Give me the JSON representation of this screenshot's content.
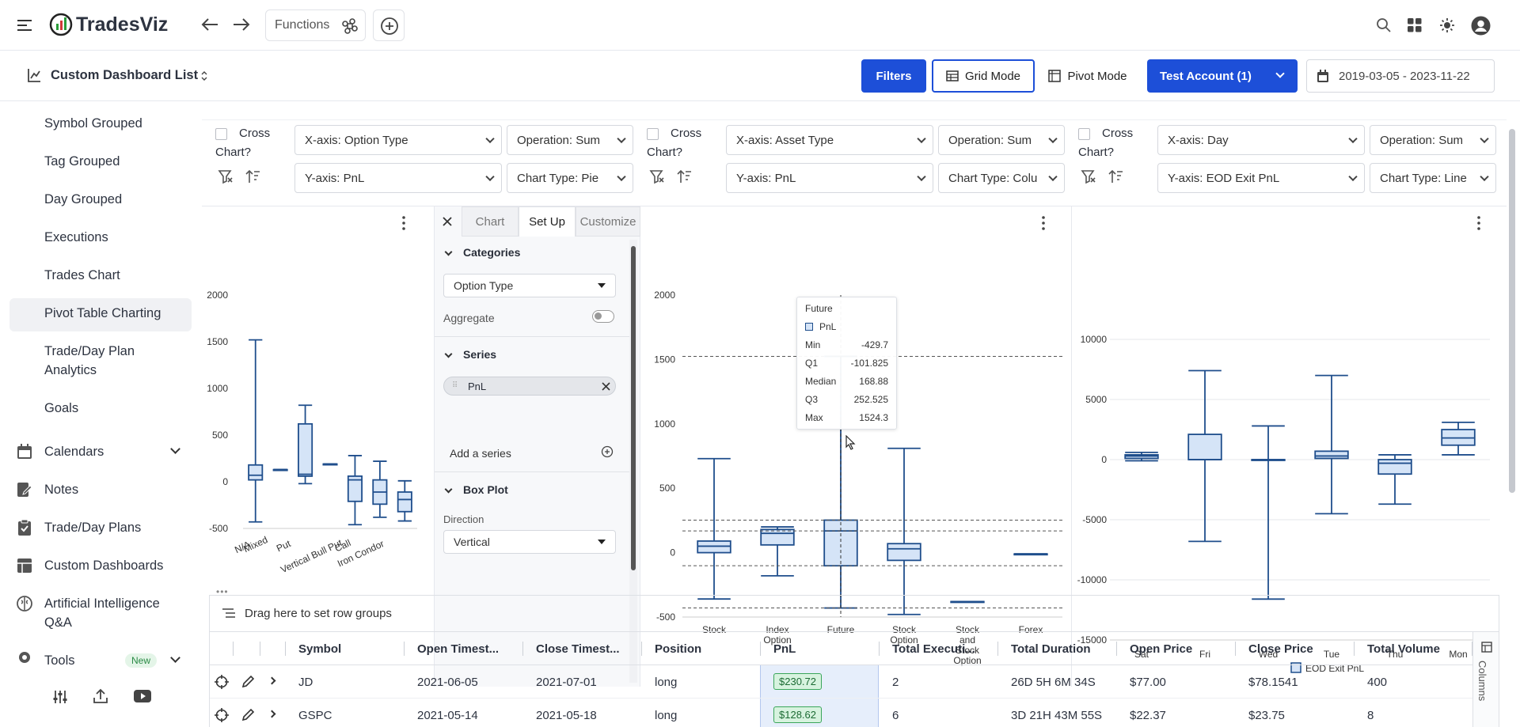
{
  "app": {
    "name": "TradesViz",
    "functions_label": "Functions"
  },
  "subbar": {
    "dashboard_title": "Custom Dashboard List",
    "filters": "Filters",
    "grid_mode": "Grid Mode",
    "pivot_mode": "Pivot Mode",
    "account": "Test Account (1)",
    "date_range": "2019-03-05 - 2023-11-22"
  },
  "sidebar": {
    "sub_items": [
      "Symbol Grouped",
      "Tag Grouped",
      "Day Grouped",
      "Executions",
      "Trades Chart",
      "Pivot Table Charting",
      "Trade/Day Plan",
      "Analytics",
      "Goals"
    ],
    "items": [
      "Calendars",
      "Notes",
      "Trade/Day Plans",
      "Custom Dashboards",
      "Artificial Intelligence",
      "Q&A",
      "Tools"
    ],
    "new_badge": "New"
  },
  "panels": [
    {
      "cross": "Cross",
      "chart": "Chart?",
      "xaxis": "X-axis: Option Type",
      "op": "Operation: Sum",
      "yaxis": "Y-axis: PnL",
      "ctype": "Chart Type: Pie"
    },
    {
      "cross": "Cross",
      "chart": "Chart?",
      "xaxis": "X-axis: Asset Type",
      "op": "Operation: Sum",
      "yaxis": "Y-axis: PnL",
      "ctype": "Chart Type: Colu"
    },
    {
      "cross": "Cross",
      "chart": "Chart?",
      "xaxis": "X-axis: Day",
      "op": "Operation: Sum",
      "yaxis": "Y-axis: EOD Exit PnL",
      "ctype": "Chart Type: Line"
    }
  ],
  "setup": {
    "tabs": [
      "Chart",
      "Set Up",
      "Customize"
    ],
    "categories": "Categories",
    "category_value": "Option Type",
    "aggregate": "Aggregate",
    "series": "Series",
    "series_chip": "PnL",
    "add_series": "Add a series",
    "box_plot": "Box Plot",
    "direction": "Direction",
    "direction_value": "Vertical"
  },
  "tooltip": {
    "title": "Future",
    "series": "PnL",
    "rows": [
      [
        "Min",
        "-429.7"
      ],
      [
        "Q1",
        "-101.825"
      ],
      [
        "Median",
        "168.88"
      ],
      [
        "Q3",
        "252.525"
      ],
      [
        "Max",
        "1524.3"
      ]
    ]
  },
  "grid": {
    "drag_hint": "Drag here to set row groups",
    "columns": [
      "Symbol",
      "Open Timest...",
      "Close Timest...",
      "Position",
      "PnL",
      "Total Executi...",
      "Total Duration",
      "Open Price",
      "Close Price",
      "Total Volume"
    ],
    "side_label": "Columns",
    "rows": [
      [
        "JD",
        "2021-06-05",
        "2021-07-01",
        "long",
        "$230.72",
        "2",
        "26D 5H 6M 34S",
        "$77.00",
        "$78.1541",
        "400"
      ],
      [
        "GSPC",
        "2021-05-14",
        "2021-05-18",
        "long",
        "$128.62",
        "6",
        "3D 21H 43M 55S",
        "$22.37",
        "$23.75",
        "8"
      ]
    ]
  },
  "chart_data": [
    {
      "type": "boxplot",
      "categories": [
        "N/A",
        "Mixed",
        "Put",
        "Vertical Bull Put",
        "Call",
        "Iron Condor"
      ],
      "boxes": [
        {
          "min": -430,
          "q1": 20,
          "median": 70,
          "q3": 180,
          "max": 1520
        },
        {
          "min": 130,
          "q1": 130,
          "median": 130,
          "q3": 130,
          "max": 130
        },
        {
          "min": -20,
          "q1": 60,
          "median": 80,
          "q3": 620,
          "max": 820
        },
        {
          "min": 190,
          "q1": 190,
          "median": 190,
          "q3": 190,
          "max": 190
        },
        {
          "min": -460,
          "q1": -210,
          "median": 20,
          "q3": 60,
          "max": 280
        },
        {
          "min": -380,
          "q1": -240,
          "median": -110,
          "q3": 20,
          "max": 220
        },
        {
          "min": -420,
          "q1": -320,
          "median": -190,
          "q3": -110,
          "max": 10
        }
      ],
      "ylim": [
        -500,
        2000
      ],
      "yticks": [
        2000,
        1500,
        1000,
        500,
        0,
        -500
      ]
    },
    {
      "type": "boxplot",
      "categories": [
        "Stock",
        "Index Option",
        "Future",
        "Stock Option",
        "Stock and Stock Option",
        "Forex"
      ],
      "boxes": [
        {
          "min": -360,
          "q1": 0,
          "median": 50,
          "q3": 90,
          "max": 730
        },
        {
          "min": -180,
          "q1": 60,
          "median": 150,
          "q3": 180,
          "max": 200
        },
        {
          "min": -429.7,
          "q1": -101.825,
          "median": 168.88,
          "q3": 252.525,
          "max": 1524.3
        },
        {
          "min": -480,
          "q1": -60,
          "median": 30,
          "q3": 70,
          "max": 810
        },
        {
          "min": -380,
          "q1": -380,
          "median": -380,
          "q3": -380,
          "max": -380
        },
        {
          "min": -10,
          "q1": -10,
          "median": -10,
          "q3": -10,
          "max": -10
        }
      ],
      "ylim": [
        -500,
        2000
      ],
      "yticks": [
        2000,
        1500,
        1000,
        500,
        0,
        -500
      ]
    },
    {
      "type": "boxplot",
      "categories": [
        "Sat",
        "Fri",
        "Wed",
        "Tue",
        "Thu",
        "Mon"
      ],
      "series": [
        {
          "name": "EOD Exit PnL"
        }
      ],
      "boxes": [
        {
          "min": -100,
          "q1": 100,
          "median": 300,
          "q3": 400,
          "max": 600
        },
        {
          "min": -6800,
          "q1": 0,
          "median": 0,
          "q3": 2100,
          "max": 7400
        },
        {
          "min": -11600,
          "q1": 0,
          "median": 0,
          "q3": 0,
          "max": 2800
        },
        {
          "min": -4500,
          "q1": 100,
          "median": 300,
          "q3": 700,
          "max": 7000
        },
        {
          "min": -3700,
          "q1": -1200,
          "median": -300,
          "q3": 0,
          "max": 400
        },
        {
          "min": 400,
          "q1": 1200,
          "median": 1800,
          "q3": 2500,
          "max": 3100
        }
      ],
      "ylim": [
        -15000,
        10000
      ],
      "yticks": [
        10000,
        5000,
        0,
        -5000,
        -10000,
        -15000
      ]
    }
  ]
}
